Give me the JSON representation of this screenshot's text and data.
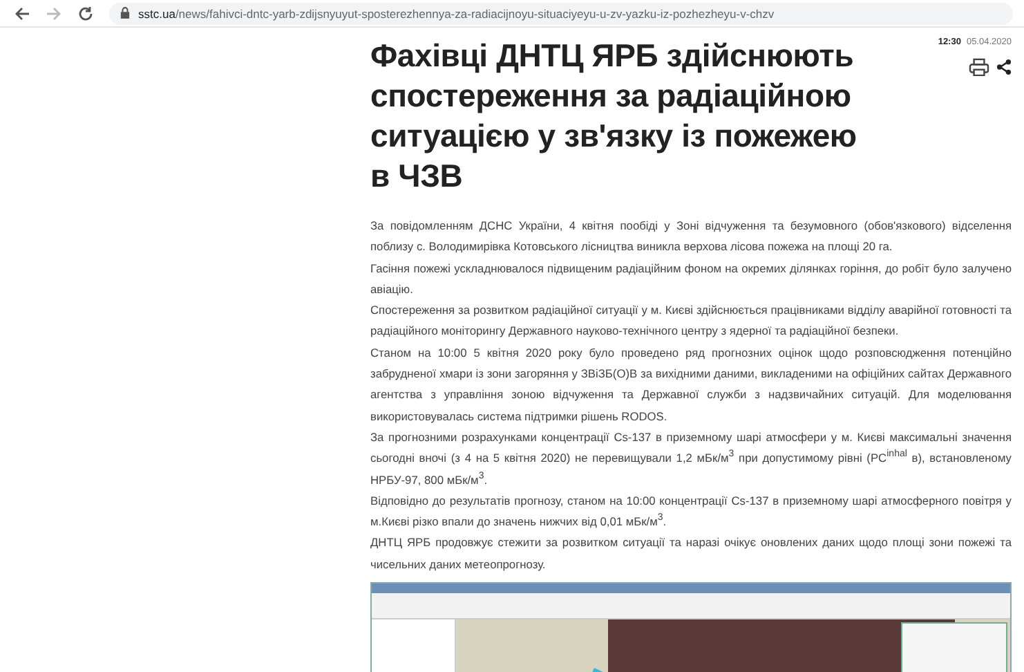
{
  "browser": {
    "url_domain": "sstc.ua",
    "url_path": "/news/fahivci-dntc-yarb-zdijsnyuyut-sposterezhennya-za-radiacijnoyu-situaciyeyu-u-zv-yazku-iz-pozhezheyu-v-chzv"
  },
  "article": {
    "title": "Фахівці ДНТЦ ЯРБ здійснюють спостереження за радіаційною ситуацією у зв'язку із пожежею в ЧЗВ",
    "time": "12:30",
    "date": "05.04.2020",
    "paragraphs": [
      "За повідомленням ДСНС України, 4 квітня пообіді у Зоні відчуження та безумовного (обов'язкового) відселення поблизу с. Володимирівка Котовського лісництва виникла верхова лісова пожежа на площі 20 га.",
      "Гасіння пожежі ускладнювалося підвищеним радіаційним фоном на окремих ділянках горіння, до робіт було залучено авіацію.",
      "Спостереження за розвитком радіаційної ситуації у м. Києві здійснюється працівниками відділу аварійної готовності та радіаційного моніторингу Державного науково-технічного центру з ядерної та радіаційної безпеки.",
      "Станом на 10:00 5 квітня 2020 року було проведено ряд прогнозних оцінок щодо розповсюдження потенційно забрудненої хмари із зони загоряння у ЗВіЗБ(О)В за вихідними даними, викладеними на офіційних сайтах Державного агентства з управління зоною відчуження та Державної служби з надзвичайних ситуацій. Для моделювання використовувалась система підтримки рішень RODOS.",
      "За прогнозними розрахунками концентрації Cs-137 в приземному шарі атмосфери у м. Києві максимальні значення сьогодні вночі (з 4 на 5 квітня 2020) не перевищували 1,2 мБк/м$^{3}$ при допустимому рівні (PC$^{inhal}$ в), встановленому НРБУ-97, 800 мБк/м$^{3}$.",
      "Відповідно до результатів прогнозу, станом на 10:00 концентрації Cs-137 в приземному шарі атмосферного повітря у м.Києві різко впали до значень нижчих від 0,01 мБк/м$^{3}$.",
      "ДНТЦ ЯРБ продовжує стежити за розвитком ситуації та наразі очікує оновлених даних щодо площі зони пожежі та чисельних даних метеопрогнозу."
    ]
  }
}
